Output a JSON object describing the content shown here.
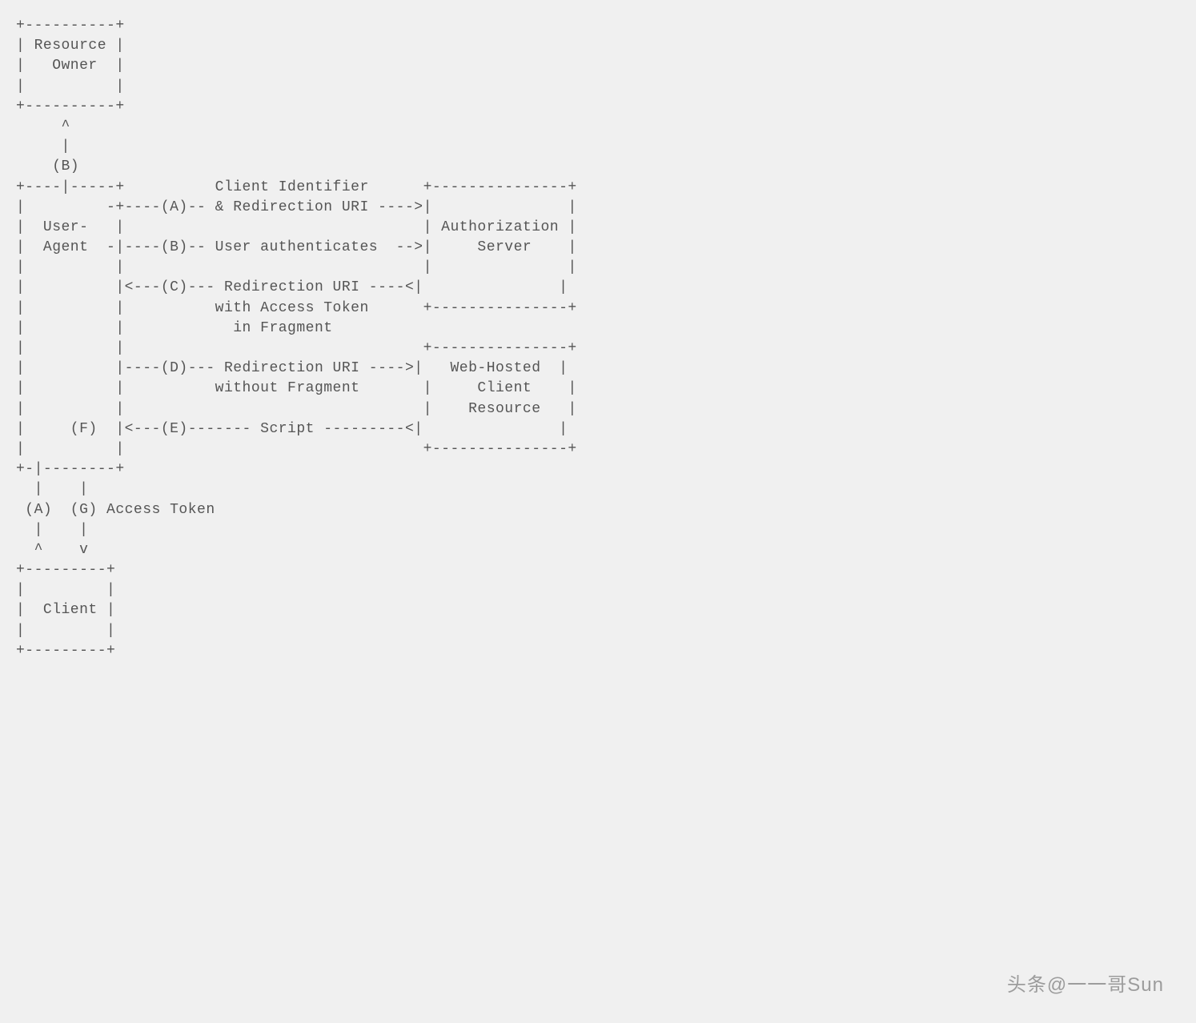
{
  "diagram": {
    "lines": [
      "+----------+",
      "| Resource |",
      "|   Owner  |",
      "|          |",
      "+----------+",
      "     ^",
      "     |",
      "    (B)",
      "+----|-----+          Client Identifier      +---------------+",
      "|         -+----(A)-- & Redirection URI ---->|               |",
      "|  User-   |                                 | Authorization |",
      "|  Agent  -|----(B)-- User authenticates  -->|     Server    |",
      "|          |                                 |               |",
      "|          |<---(C)--- Redirection URI ----<|               |",
      "|          |          with Access Token      +---------------+",
      "|          |            in Fragment",
      "|          |                                 +---------------+",
      "|          |----(D)--- Redirection URI ---->|   Web-Hosted  |",
      "|          |          without Fragment       |     Client    |",
      "|          |                                 |    Resource   |",
      "|     (F)  |<---(E)------- Script ---------<|               |",
      "|          |                                 +---------------+",
      "+-|--------+",
      "  |    |",
      " (A)  (G) Access Token",
      "  |    |",
      "  ^    v",
      "+---------+",
      "|         |",
      "|  Client |",
      "|         |",
      "+---------+"
    ]
  },
  "watermark": "头条@一一哥Sun",
  "entities": {
    "resource_owner": "Resource Owner",
    "user_agent": "User-Agent",
    "authorization_server": "Authorization Server",
    "web_hosted_client_resource": "Web-Hosted Client Resource",
    "client": "Client"
  },
  "flows": {
    "A": "Client Identifier & Redirection URI",
    "B": "User authenticates",
    "C": "Redirection URI with Access Token in Fragment",
    "D": "Redirection URI without Fragment",
    "E": "Script",
    "F": "",
    "G": "Access Token"
  }
}
